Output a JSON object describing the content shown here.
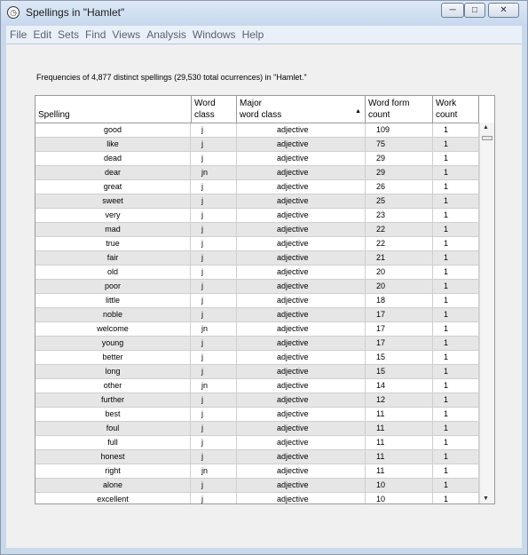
{
  "window": {
    "title": "Spellings in \"Hamlet\"",
    "app_icon": "clock-icon",
    "controls": {
      "minimize": "─",
      "maximize": "□",
      "close": "✕"
    }
  },
  "menu": [
    "File",
    "Edit",
    "Sets",
    "Find",
    "Views",
    "Analysis",
    "Windows",
    "Help"
  ],
  "caption": "Frequencies of 4,877 distinct spellings (29,530 total ocurrences) in \"Hamlet.\"",
  "table": {
    "headers": {
      "spelling": "Spelling",
      "word_class": "Word\nclass",
      "major_word_class": "Major\nword class",
      "word_form_count": "Word form\ncount",
      "work_count": "Work\ncount"
    },
    "sorted_column": "major_word_class",
    "sort_direction": "ascending",
    "rows": [
      [
        "good",
        "j",
        "adjective",
        "109",
        "1"
      ],
      [
        "like",
        "j",
        "adjective",
        "75",
        "1"
      ],
      [
        "dead",
        "j",
        "adjective",
        "29",
        "1"
      ],
      [
        "dear",
        "jn",
        "adjective",
        "29",
        "1"
      ],
      [
        "great",
        "j",
        "adjective",
        "26",
        "1"
      ],
      [
        "sweet",
        "j",
        "adjective",
        "25",
        "1"
      ],
      [
        "very",
        "j",
        "adjective",
        "23",
        "1"
      ],
      [
        "mad",
        "j",
        "adjective",
        "22",
        "1"
      ],
      [
        "true",
        "j",
        "adjective",
        "22",
        "1"
      ],
      [
        "fair",
        "j",
        "adjective",
        "21",
        "1"
      ],
      [
        "old",
        "j",
        "adjective",
        "20",
        "1"
      ],
      [
        "poor",
        "j",
        "adjective",
        "20",
        "1"
      ],
      [
        "little",
        "j",
        "adjective",
        "18",
        "1"
      ],
      [
        "noble",
        "j",
        "adjective",
        "17",
        "1"
      ],
      [
        "welcome",
        "jn",
        "adjective",
        "17",
        "1"
      ],
      [
        "young",
        "j",
        "adjective",
        "17",
        "1"
      ],
      [
        "better",
        "j",
        "adjective",
        "15",
        "1"
      ],
      [
        "long",
        "j",
        "adjective",
        "15",
        "1"
      ],
      [
        "other",
        "jn",
        "adjective",
        "14",
        "1"
      ],
      [
        "further",
        "j",
        "adjective",
        "12",
        "1"
      ],
      [
        "best",
        "j",
        "adjective",
        "11",
        "1"
      ],
      [
        "foul",
        "j",
        "adjective",
        "11",
        "1"
      ],
      [
        "full",
        "j",
        "adjective",
        "11",
        "1"
      ],
      [
        "honest",
        "j",
        "adjective",
        "11",
        "1"
      ],
      [
        "right",
        "jn",
        "adjective",
        "11",
        "1"
      ],
      [
        "alone",
        "j",
        "adjective",
        "10",
        "1"
      ],
      [
        "excellent",
        "j",
        "adjective",
        "10",
        "1"
      ]
    ]
  },
  "scrollbar": {
    "up_icon": "▲",
    "down_icon": "▼"
  }
}
